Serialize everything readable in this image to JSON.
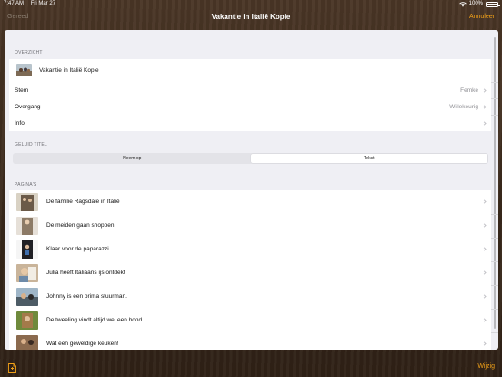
{
  "statusbar": {
    "time": "7:47 AM",
    "date": "Fri Mar 27",
    "battery": "100%"
  },
  "navbar": {
    "left": "Gereed",
    "title": "Vakantie in Italië Kopie",
    "right": "Annuleer"
  },
  "overview": {
    "header": "OVERZICHT",
    "project_title": "Vakantie in Italië Kopie",
    "rows": [
      {
        "label": "Stem",
        "value": "Femke"
      },
      {
        "label": "Overgang",
        "value": "Willekeurig"
      },
      {
        "label": "Info",
        "value": ""
      }
    ]
  },
  "sound_title": {
    "header": "GELUID TITEL",
    "options": [
      "Neem op",
      "Tekst"
    ],
    "selected": "Tekst"
  },
  "pages": {
    "header": "PAGINA'S",
    "items": [
      {
        "label": "De familie Ragsdale in Italië"
      },
      {
        "label": "De meiden gaan shoppen"
      },
      {
        "label": "Klaar voor de paparazzi"
      },
      {
        "label": "Julia heeft Italiaans ijs ontdekt"
      },
      {
        "label": "Johnny is een prima stuurman."
      },
      {
        "label": "De tweeling vindt altijd wel een hond"
      },
      {
        "label": "Wat een geweldige keuken!"
      }
    ]
  },
  "toolbar": {
    "edit_label": "Wijzig",
    "icon": "document-icon"
  },
  "colors": {
    "accent": "#f0a018",
    "background": "#efeff4"
  }
}
